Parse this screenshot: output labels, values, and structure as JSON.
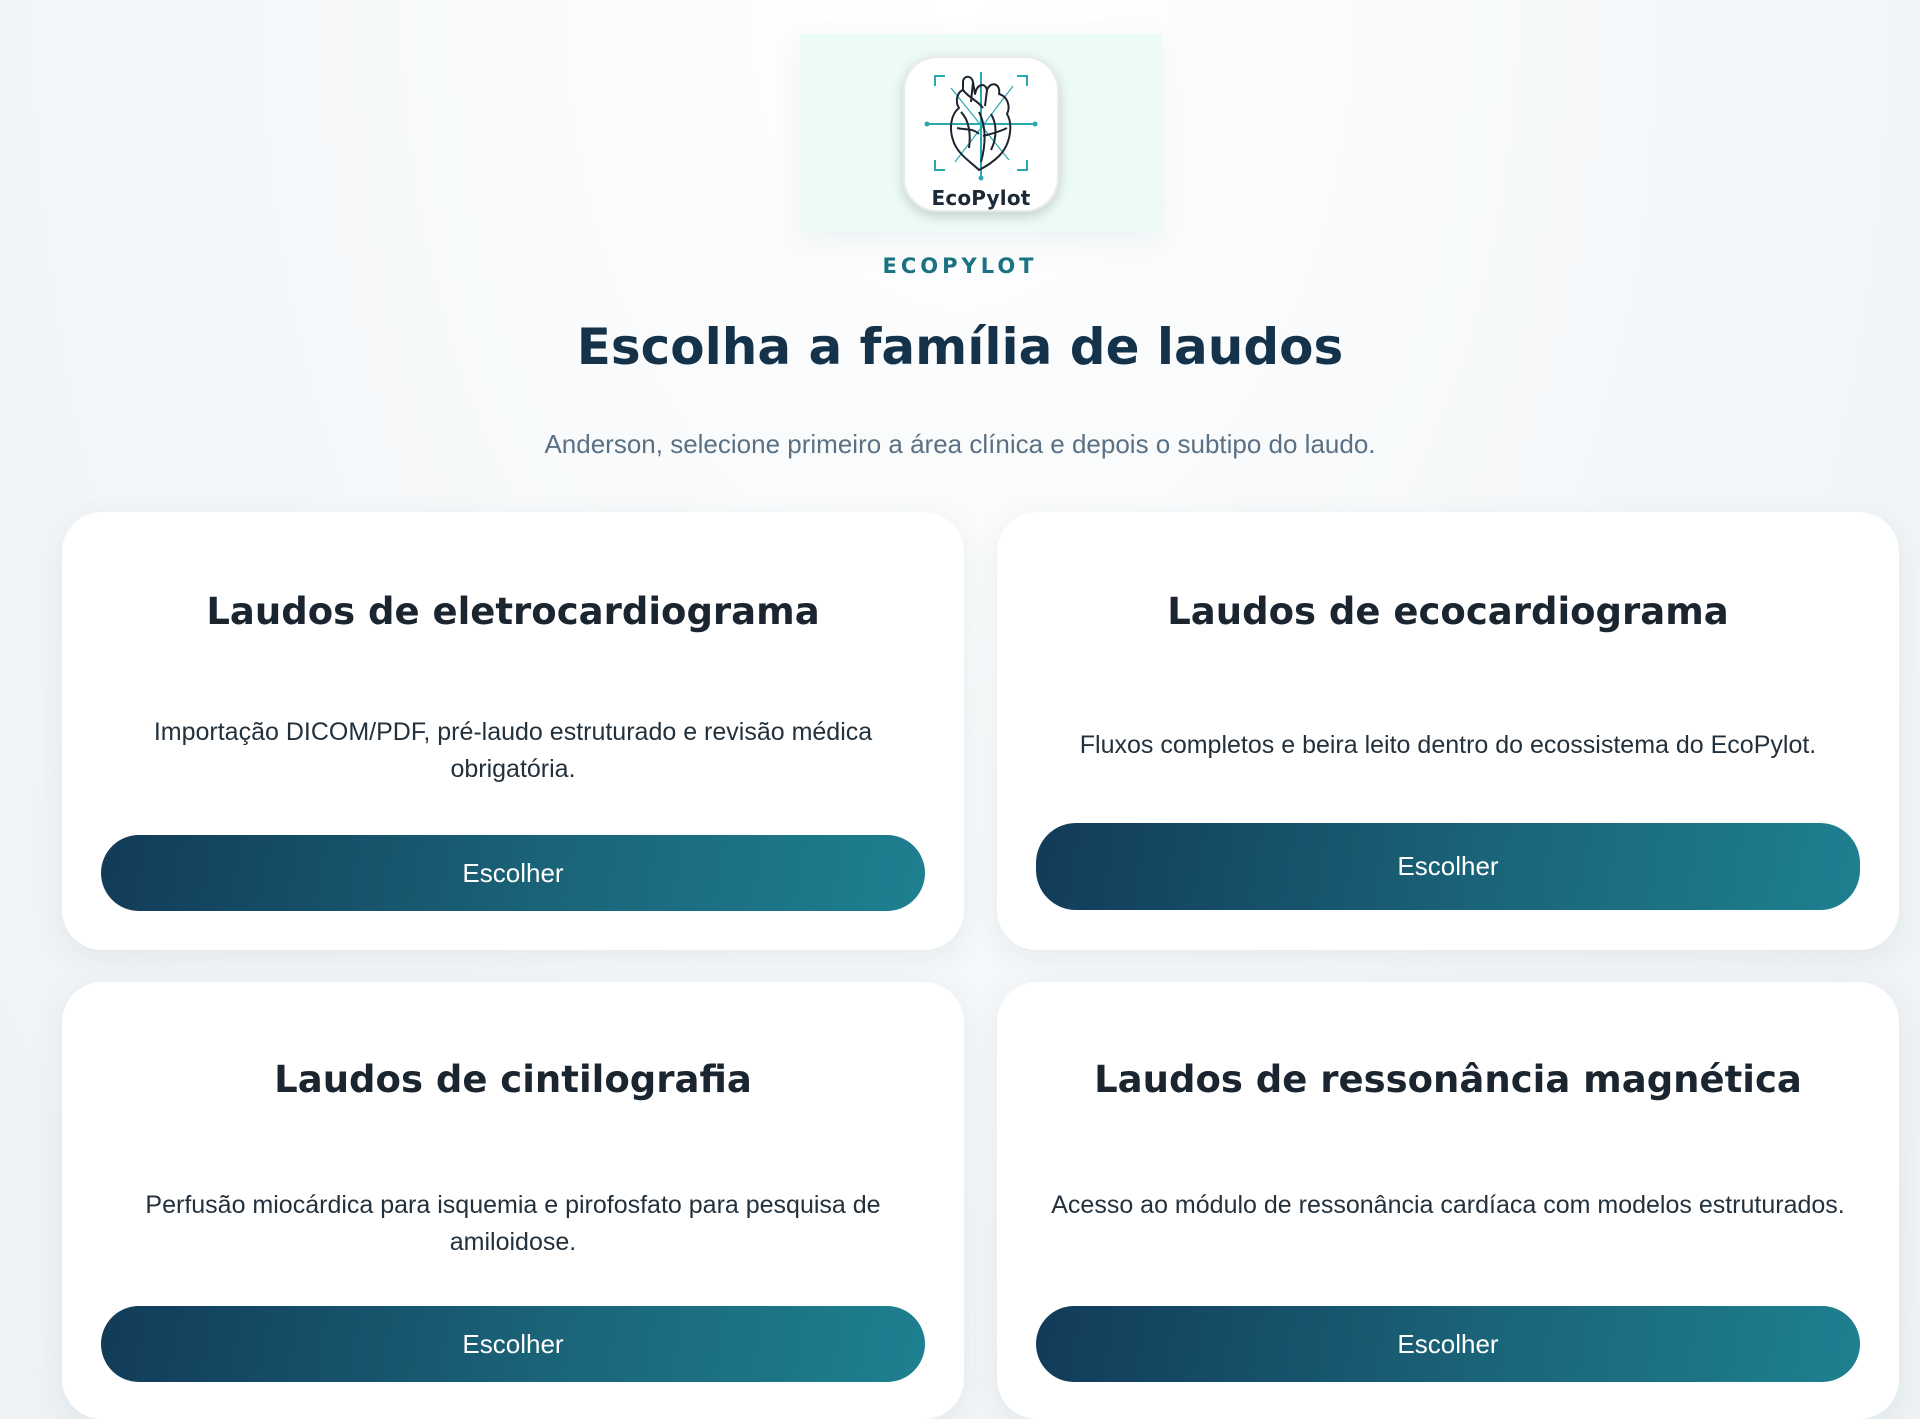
{
  "logo": {
    "wordmark": "EcoPylot",
    "icon": "heart-anatomy-icon"
  },
  "brand": "ECOPYLOT",
  "title": "Escolha a família de laudos",
  "subtitle": "Anderson, selecione primeiro a área clínica e depois o subtipo do laudo.",
  "colors": {
    "accent": "#1a7282",
    "title": "#14324a",
    "button_start": "#123b58",
    "button_end": "#1e8090"
  },
  "cards": [
    {
      "title": "Laudos de eletrocardiograma",
      "description": "Importação DICOM/PDF, pré-laudo estruturado e revisão médica obrigatória.",
      "button": "Escolher"
    },
    {
      "title": "Laudos de ecocardiograma",
      "description": "Fluxos completos e beira leito dentro do ecossistema do EcoPylot.",
      "button": "Escolher"
    },
    {
      "title": "Laudos de cintilografia",
      "description": "Perfusão miocárdica para isquemia e pirofosfato para pesquisa de amiloidose.",
      "button": "Escolher"
    },
    {
      "title": "Laudos de ressonância magnética",
      "description": "Acesso ao módulo de ressonância cardíaca com modelos estruturados.",
      "button": "Escolher"
    }
  ]
}
